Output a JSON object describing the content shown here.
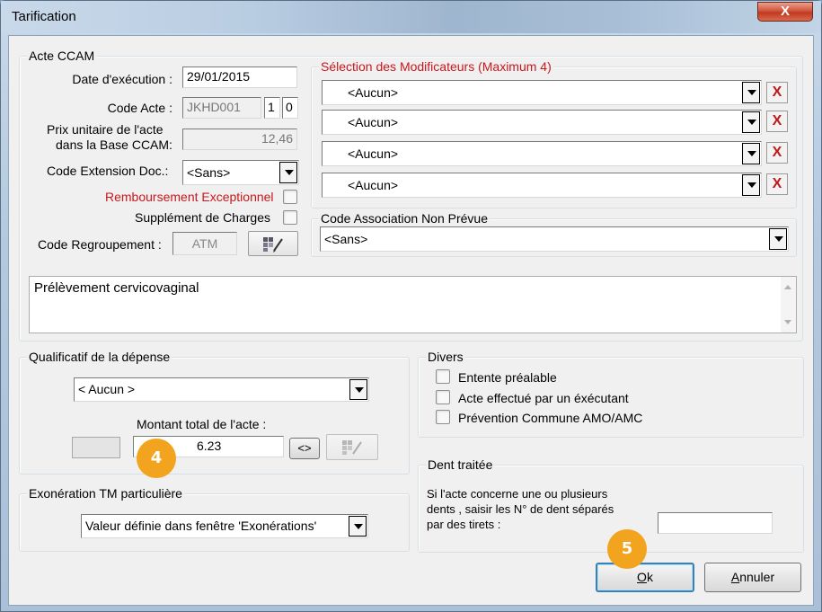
{
  "window": {
    "title": "Tarification",
    "close_label": "X"
  },
  "acte": {
    "legend": "Acte CCAM",
    "date_label": "Date d'exécution :",
    "date_value": "29/01/2015",
    "code_label": "Code Acte :",
    "code_value": "JKHD001",
    "code_part2": "1",
    "code_part3": "0",
    "prix_label_1": "Prix unitaire de l'acte",
    "prix_label_2": "dans la Base CCAM:",
    "prix_value": "12,46",
    "ext_label": "Code Extension Doc.:",
    "ext_value": "<Sans>",
    "rembours_label": "Remboursement Exceptionnel",
    "supplement_label": "Supplément de Charges",
    "regroup_label": "Code Regroupement :",
    "regroup_value": "ATM",
    "description": "Prélèvement cervicovaginal"
  },
  "modificateurs": {
    "legend": "Sélection des Modificateurs (Maximum 4)",
    "items": [
      "<Aucun>",
      "<Aucun>",
      "<Aucun>",
      "<Aucun>"
    ],
    "remove_label": "X"
  },
  "association": {
    "legend": "Code Association Non Prévue",
    "value": "<Sans>"
  },
  "qualificatif": {
    "legend": "Qualificatif de la dépense",
    "value": "< Aucun >",
    "montant_label": "Montant total de l'acte :",
    "montant_value": "6.23",
    "toggle_label": "<>"
  },
  "divers": {
    "legend": "Divers",
    "items": [
      "Entente préalable",
      "Acte effectué par un éxécutant",
      "Prévention Commune AMO/AMC"
    ]
  },
  "exoneration": {
    "legend": "Exonération TM particulière",
    "value": "Valeur définie dans fenêtre 'Exonérations'"
  },
  "dent": {
    "legend": "Dent traitée",
    "line1": "Si l'acte concerne une ou plusieurs",
    "line2": "dents , saisir les N° de dent séparés",
    "line3": "par des tirets :",
    "value": ""
  },
  "buttons": {
    "ok_first": "O",
    "ok_rest": "k",
    "cancel_first": "A",
    "cancel_rest": "nnuler"
  },
  "badges": {
    "b4": "4",
    "b5": "5"
  },
  "colors": {
    "accent_red": "#c8171d",
    "badge": "#f2a41f"
  }
}
